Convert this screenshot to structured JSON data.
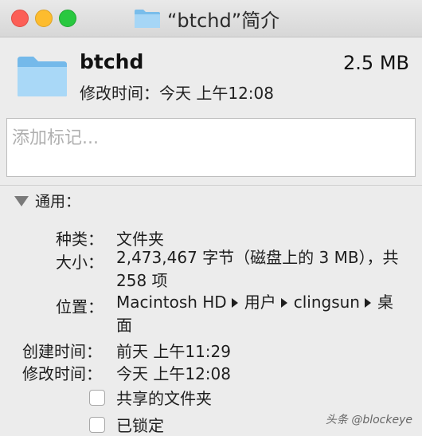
{
  "window": {
    "title": "“btchd”简介"
  },
  "header": {
    "name": "btchd",
    "size": "2.5 MB",
    "modified": "修改时间：今天 上午12:08"
  },
  "tags": {
    "placeholder": "添加标记..."
  },
  "general": {
    "section_label": "通用：",
    "kind_label": "种类：",
    "kind_value": "文件夹",
    "size_label": "大小：",
    "size_value": "2,473,467 字节（磁盘上的 3 MB），共 258 项",
    "location_label": "位置：",
    "location_path": [
      "Macintosh HD",
      "用户",
      "clingsun",
      "桌面"
    ],
    "created_label": "创建时间：",
    "created_value": "前天 上午11:29",
    "modified_label": "修改时间：",
    "modified_value": "今天 上午12:08",
    "shared_folder_label": "共享的文件夹",
    "locked_label": "已锁定"
  },
  "watermark": "头条 @blockeye",
  "colors": {
    "folder_light": "#a9d8f7",
    "folder_dark": "#6fb6e9"
  }
}
